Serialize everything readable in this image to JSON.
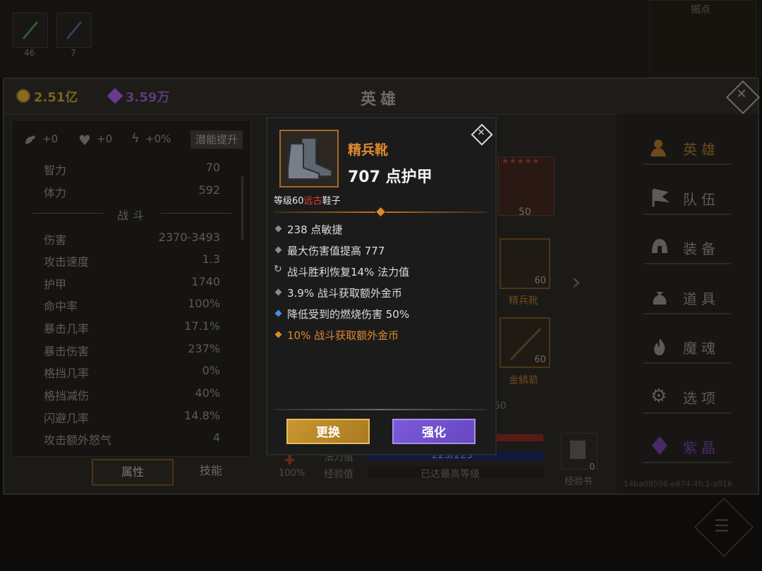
{
  "top_slots": [
    {
      "count": "46",
      "icon": "sword-icon"
    },
    {
      "count": "7",
      "icon": "quill-icon"
    }
  ],
  "map_label": "据点",
  "header": {
    "gold": "2.51亿",
    "gems": "3.59万",
    "title": "英雄"
  },
  "left": {
    "boosts": [
      {
        "icon": "strength-arm-icon",
        "value": "+0"
      },
      {
        "icon": "heart-icon",
        "value": "+0"
      },
      {
        "icon": "lightning-icon",
        "value": "+0%"
      }
    ],
    "potential_button": "潜能提升",
    "stats_top": [
      {
        "label": "智力",
        "value": "70"
      },
      {
        "label": "体力",
        "value": "592"
      }
    ],
    "section": "战斗",
    "stats": [
      {
        "label": "伤害",
        "value": "2370-3493"
      },
      {
        "label": "攻击速度",
        "value": "1.3"
      },
      {
        "label": "护甲",
        "value": "1740"
      },
      {
        "label": "命中率",
        "value": "100%"
      },
      {
        "label": "暴击几率",
        "value": "17.1%"
      },
      {
        "label": "暴击伤害",
        "value": "237%"
      },
      {
        "label": "格挡几率",
        "value": "0%"
      },
      {
        "label": "格挡减伤",
        "value": "40%"
      },
      {
        "label": "闪避几率",
        "value": "14.8%"
      },
      {
        "label": "攻击额外怒气",
        "value": "4"
      }
    ],
    "tabs": [
      "属性",
      "技能"
    ]
  },
  "middle": {
    "hero_level": "50",
    "boots_slot": {
      "level": "60",
      "name": "精兵靴"
    },
    "arrow_slot": {
      "level": "60",
      "name": "金鳞箭"
    },
    "partial_level": "60",
    "mana_label": "法力值",
    "mana_value": "225/225",
    "exp_label": "经验值",
    "exp_value": "已达最高等级",
    "health_pct": "100%",
    "exp_book_count": "0",
    "exp_book_label": "经验书",
    "id_text": "14ba08506-e674-4fc1-a916"
  },
  "nav": [
    {
      "label": "英雄",
      "icon": "hero-icon",
      "active": true
    },
    {
      "label": "队伍",
      "icon": "flag-icon"
    },
    {
      "label": "装备",
      "icon": "helmet-icon"
    },
    {
      "label": "道具",
      "icon": "bag-icon"
    },
    {
      "label": "魔魂",
      "icon": "flame-icon"
    },
    {
      "label": "选项",
      "icon": "gear-icon"
    },
    {
      "label": "紫晶",
      "icon": "crystal-icon"
    }
  ],
  "tooltip": {
    "name": "精兵靴",
    "armor": "707 点护甲",
    "level_prefix": "等级60",
    "rarity": "远古",
    "slot_type": "鞋子",
    "affixes": [
      {
        "text": "238 点敏捷",
        "marker": "gray"
      },
      {
        "text": "最大伤害值提高 777",
        "marker": "gray"
      },
      {
        "text": "战斗胜利恢复14% 法力值",
        "marker": "cycle"
      },
      {
        "text": "3.9% 战斗获取额外金币",
        "marker": "gray"
      },
      {
        "text": "降低受到的燃烧伤害 50%",
        "marker": "blue"
      },
      {
        "text": "10% 战斗获取额外金币",
        "marker": "orange"
      }
    ],
    "replace_button": "更换",
    "upgrade_button": "强化"
  },
  "colors": {
    "item_name": "#e0892f",
    "rarity": "#e8412f",
    "orange_affix": "#e0892f",
    "blue_marker": "#4c8fd8",
    "gold_button": "#c9962f",
    "purple_button": "#7d5ad8"
  }
}
